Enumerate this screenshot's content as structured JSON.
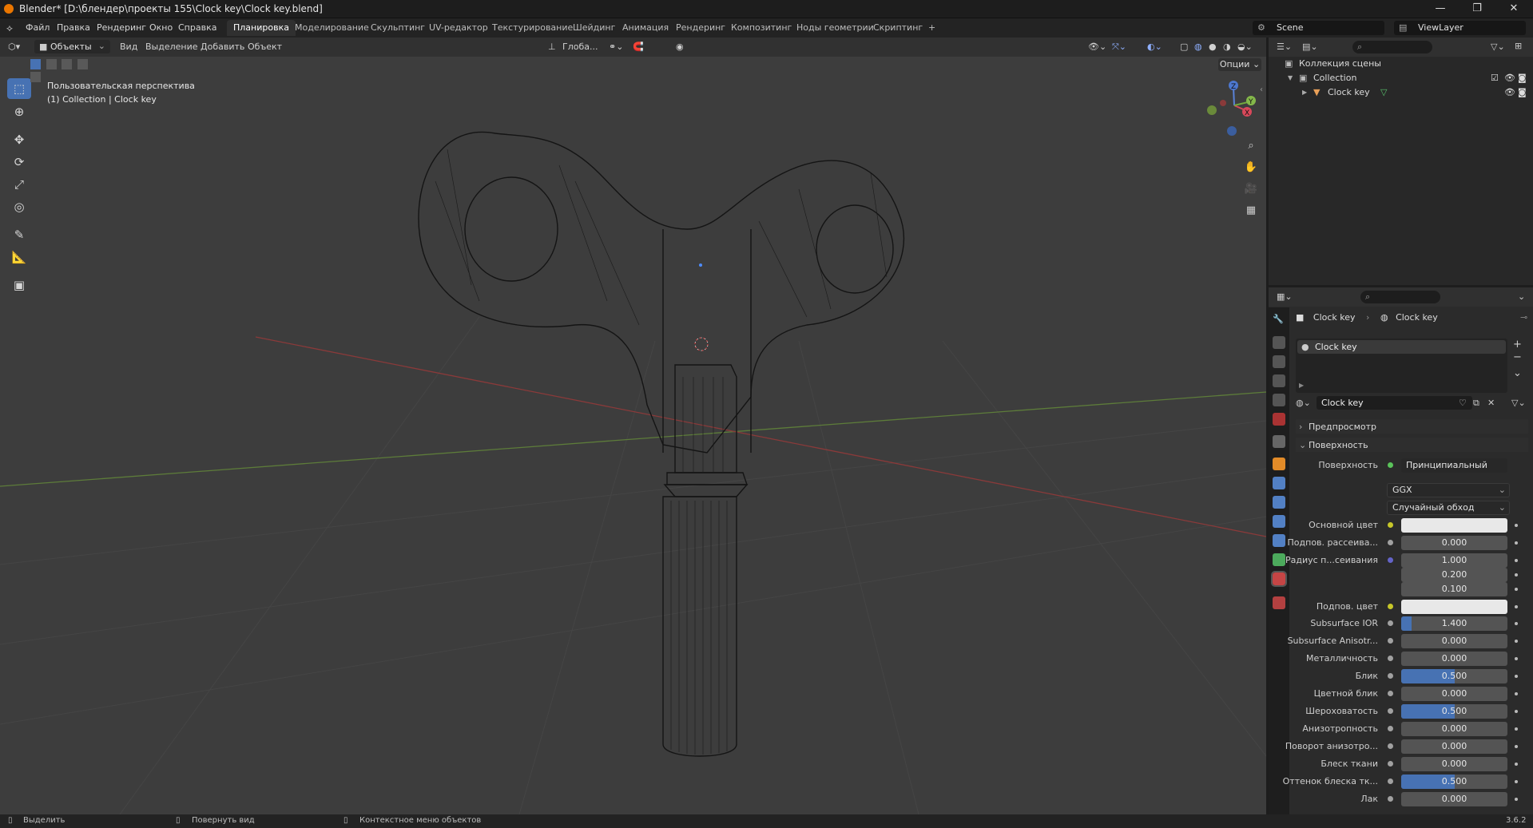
{
  "window": {
    "title": "Blender* [D:\\блендер\\проекты 155\\Clock key\\Clock key.blend]",
    "minimize": "—",
    "restore": "❐",
    "close": "✕"
  },
  "menu": [
    "Файл",
    "Правка",
    "Рендеринг",
    "Окно",
    "Справка"
  ],
  "workspaces": [
    "Планировка",
    "Моделирование",
    "Скульптинг",
    "UV-редактор",
    "Текстурирование",
    "Шейдинг",
    "Анимация",
    "Рендеринг",
    "Композитинг",
    "Ноды геометрии",
    "Скриптинг",
    "+"
  ],
  "scene": "Scene",
  "viewlayer": "ViewLayer",
  "viewport_header": {
    "mode": "Объекты",
    "menus": [
      "Вид",
      "Выделение",
      "Добавить",
      "Объект"
    ],
    "transform": "Глоба...",
    "options": "Опции"
  },
  "viewport_overlay": {
    "line1": "Пользовательская перспектива",
    "line2": "(1) Collection | Clock key"
  },
  "gizmo": {
    "z": "Z",
    "x": "X",
    "y": "Y"
  },
  "outliner": {
    "scene_collection": "Коллекция сцены",
    "collection": "Collection",
    "object": "Clock key"
  },
  "properties": {
    "breadcrumb_object": "Clock key",
    "breadcrumb_material": "Clock key",
    "slot_name": "Clock key",
    "material_name": "Clock key",
    "panel_preview": "Предпросмотр",
    "panel_surface": "Поверхность",
    "surface_label": "Поверхность",
    "surface_shader": "Принципиальный BSDF",
    "distribution": "GGX",
    "subsurface_method": "Случайный обход",
    "rows": [
      {
        "label": "Основной цвет",
        "value": "",
        "type": "color",
        "fill": 0
      },
      {
        "label": "Подпов. рассеива...",
        "value": "0.000",
        "type": "num",
        "fill": 0
      },
      {
        "label": "Радиус п...сеивания",
        "value": "1.000",
        "type": "num",
        "fill": 0
      },
      {
        "label": "",
        "value": "0.200",
        "type": "num",
        "fill": 0
      },
      {
        "label": "",
        "value": "0.100",
        "type": "num",
        "fill": 0
      },
      {
        "label": "Подпов. цвет",
        "value": "",
        "type": "color",
        "fill": 0
      },
      {
        "label": "Subsurface IOR",
        "value": "1.400",
        "type": "num",
        "fill": 0.1
      },
      {
        "label": "Subsurface Anisotr...",
        "value": "0.000",
        "type": "num",
        "fill": 0
      },
      {
        "label": "Металличность",
        "value": "0.000",
        "type": "num",
        "fill": 0
      },
      {
        "label": "Блик",
        "value": "0.500",
        "type": "num",
        "fill": 0.5
      },
      {
        "label": "Цветной блик",
        "value": "0.000",
        "type": "num",
        "fill": 0
      },
      {
        "label": "Шероховатость",
        "value": "0.500",
        "type": "num",
        "fill": 0.5
      },
      {
        "label": "Анизотропность",
        "value": "0.000",
        "type": "num",
        "fill": 0
      },
      {
        "label": "Поворот анизотро...",
        "value": "0.000",
        "type": "num",
        "fill": 0
      },
      {
        "label": "Блеск ткани",
        "value": "0.000",
        "type": "num",
        "fill": 0
      },
      {
        "label": "Оттенок блеска тк...",
        "value": "0.500",
        "type": "num",
        "fill": 0.5
      },
      {
        "label": "Лак",
        "value": "0.000",
        "type": "num",
        "fill": 0
      }
    ]
  },
  "statusbar": {
    "select": "Выделить",
    "rotate": "Повернуть вид",
    "context": "Контекстное меню объектов",
    "version": "3.6.2"
  },
  "colors": {
    "accent": "#4772b3",
    "viewport_bg": "#3d3d3d",
    "panel_bg": "#2b2b2b"
  }
}
